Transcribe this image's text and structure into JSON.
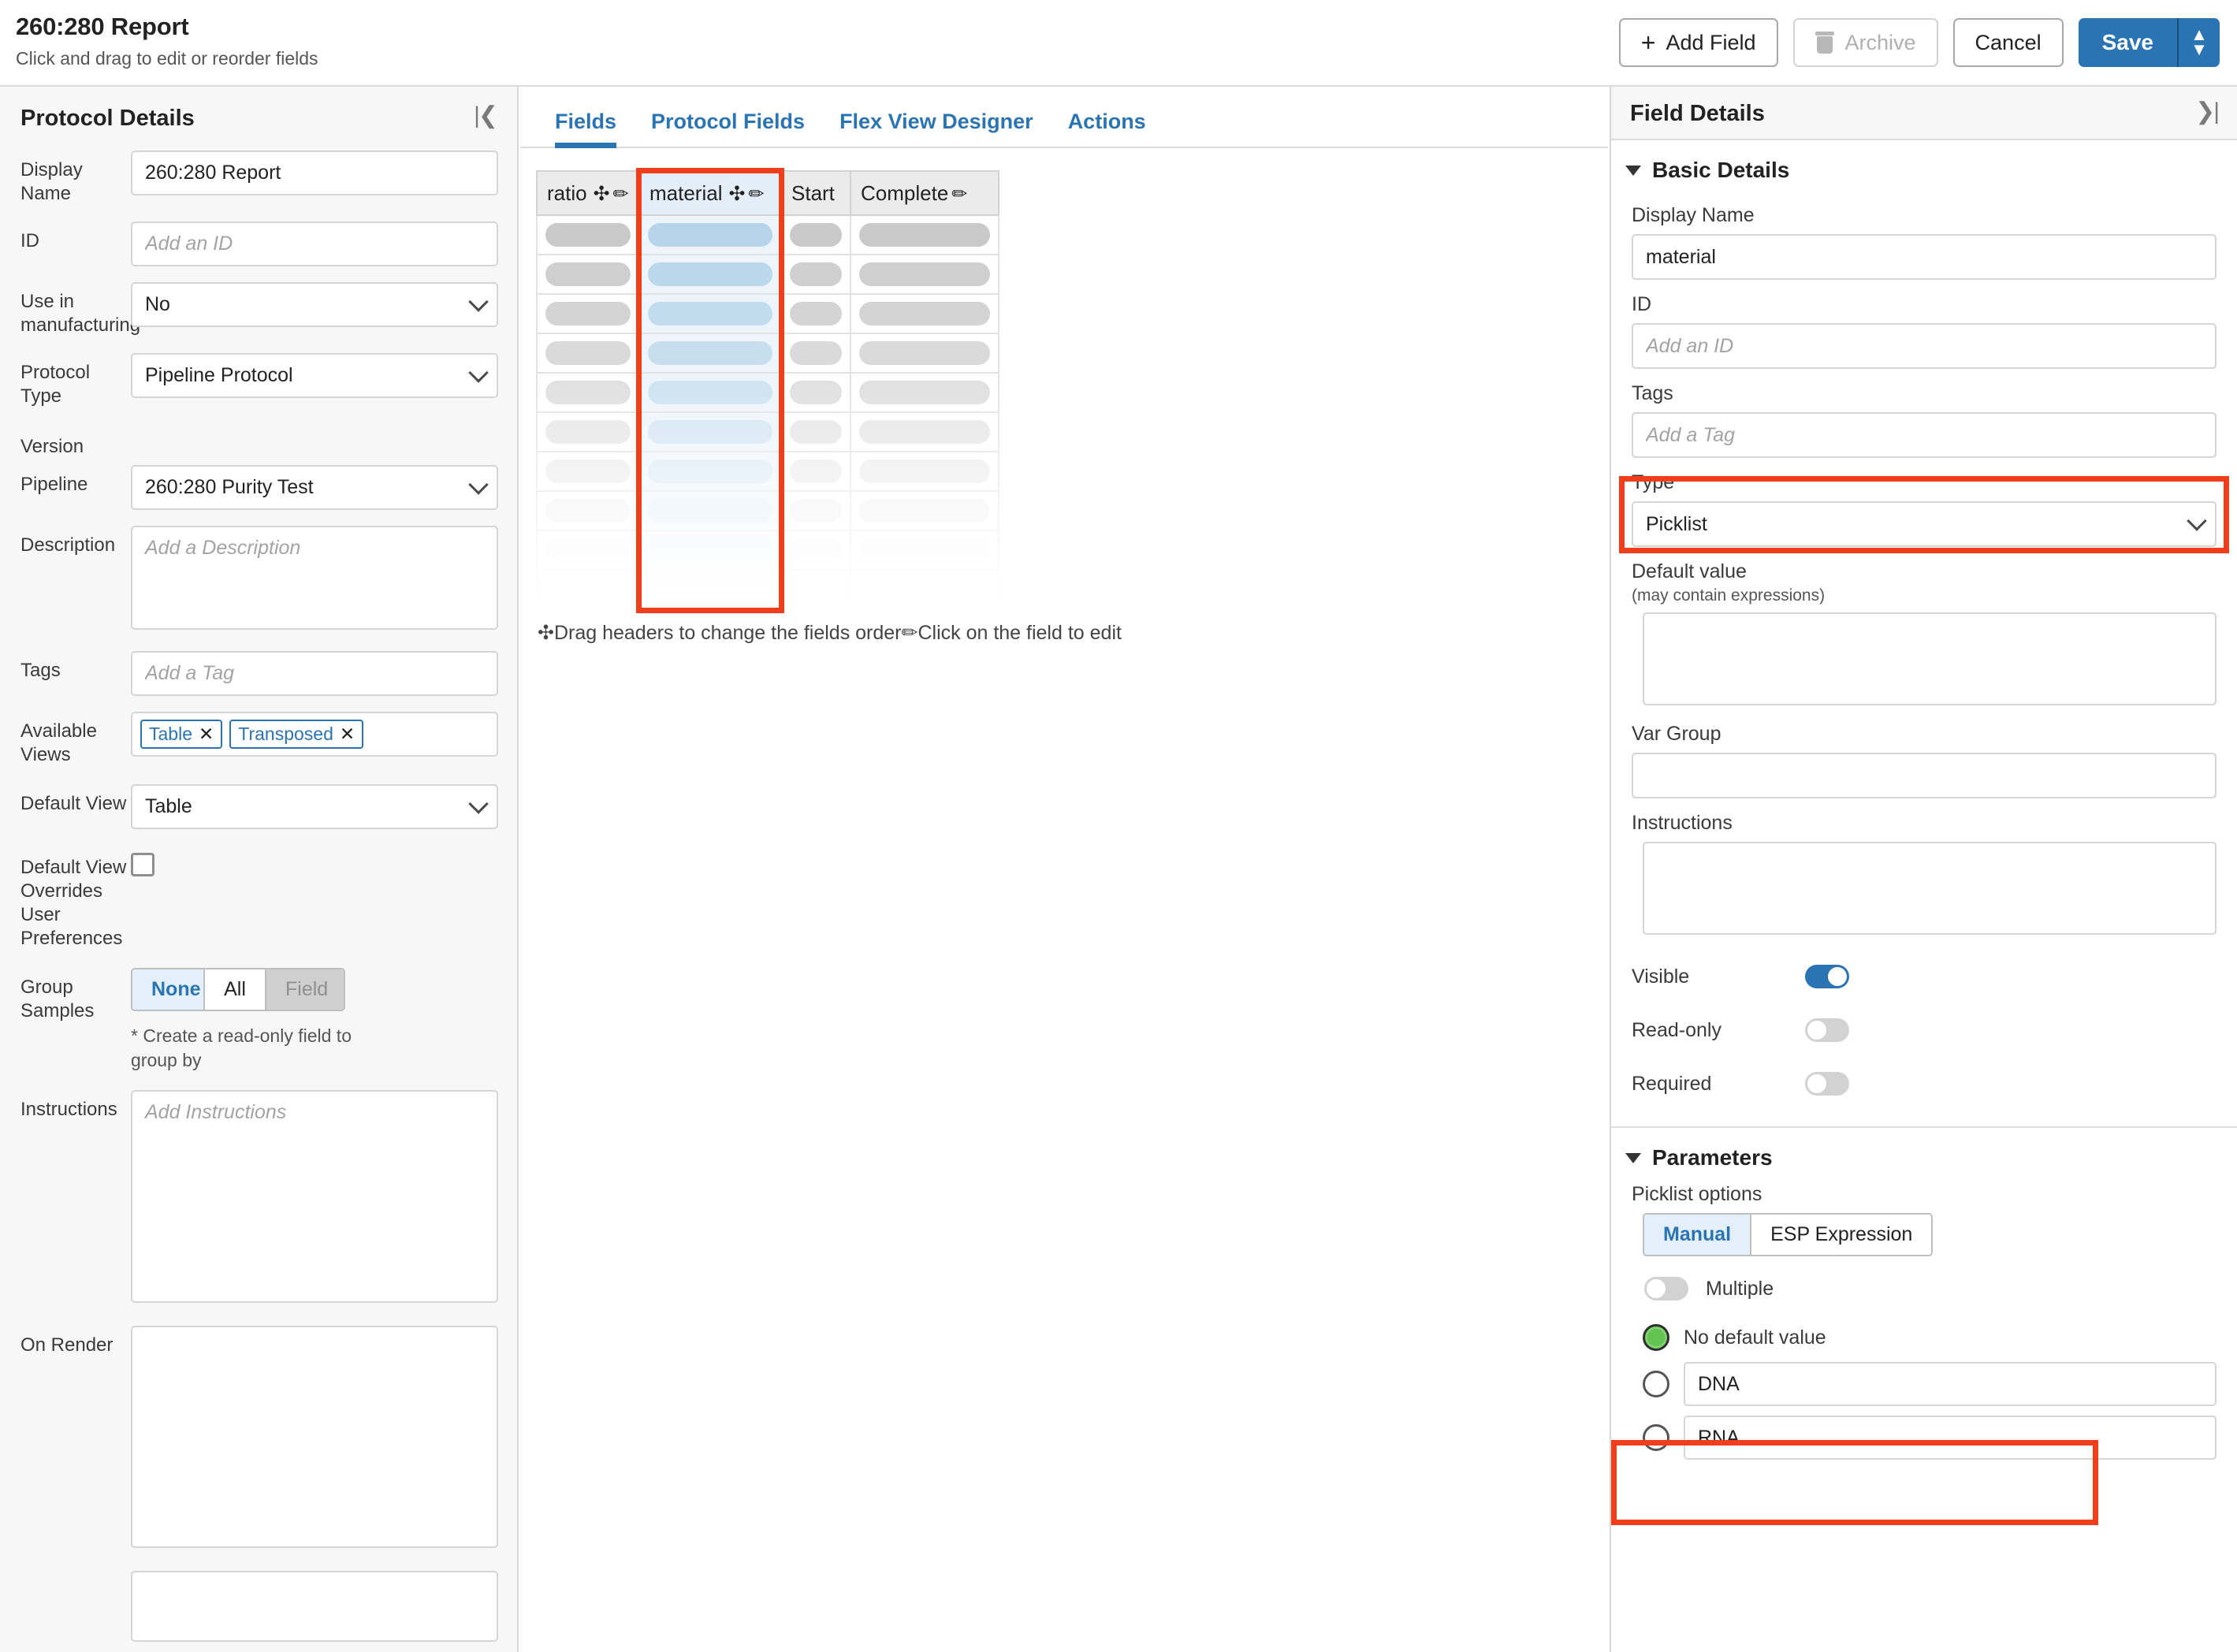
{
  "header": {
    "title": "260:280 Report",
    "subtitle": "Click and drag to edit or reorder fields",
    "add_field_label": "Add Field",
    "archive_label": "Archive",
    "cancel_label": "Cancel",
    "save_label": "Save",
    "accent_color": "#2b74b3",
    "highlight_color": "#f03d1a"
  },
  "left_panel": {
    "title": "Protocol Details",
    "collapse_icon": "collapse-left-icon",
    "display_name": {
      "label": "Display Name",
      "value": "260:280 Report"
    },
    "id": {
      "label": "ID",
      "value": "",
      "placeholder": "Add an ID"
    },
    "use_in_manufacturing": {
      "label": "Use in manufacturing",
      "value": "No"
    },
    "protocol_type": {
      "label": "Protocol Type",
      "value": "Pipeline Protocol"
    },
    "version": {
      "label": "Version",
      "value": ""
    },
    "pipeline": {
      "label": "Pipeline",
      "value": "260:280 Purity Test"
    },
    "description": {
      "label": "Description",
      "value": "",
      "placeholder": "Add a Description"
    },
    "tags": {
      "label": "Tags",
      "value": "",
      "placeholder": "Add a Tag"
    },
    "available_views": {
      "label": "Available Views",
      "chips": [
        "Table",
        "Transposed"
      ]
    },
    "default_view": {
      "label": "Default View",
      "value": "Table"
    },
    "default_view_overrides": {
      "label": "Default View Overrides User Preferences",
      "checked": false
    },
    "group_samples": {
      "label": "Group Samples",
      "options": [
        "None",
        "All",
        "Field"
      ],
      "selected": "None",
      "disabled": [
        "Field"
      ],
      "hint": "* Create a read-only field to group by"
    },
    "instructions": {
      "label": "Instructions",
      "value": "",
      "placeholder": "Add Instructions"
    },
    "on_render": {
      "label": "On Render",
      "value": ""
    }
  },
  "center_panel": {
    "tabs": [
      {
        "label": "Fields",
        "active": true
      },
      {
        "label": "Protocol Fields",
        "active": false
      },
      {
        "label": "Flex View Designer",
        "active": false
      },
      {
        "label": "Actions",
        "active": false
      }
    ],
    "table": {
      "columns": [
        {
          "label": "ratio",
          "has_move": true,
          "has_pencil": true,
          "selected": false,
          "width": 130
        },
        {
          "label": "material",
          "has_move": true,
          "has_pencil": true,
          "selected": true,
          "width": 180
        },
        {
          "label": "Start",
          "has_move": false,
          "has_pencil": false,
          "selected": false,
          "width": 88
        },
        {
          "label": "Complete",
          "has_move": false,
          "has_pencil": true,
          "selected": false,
          "width": 188
        }
      ],
      "row_count": 10
    },
    "legend_move_icon": "move-icon",
    "legend_move_text": "Drag headers to change the fields order",
    "legend_pencil_icon": "pencil-icon",
    "legend_pencil_text": "Click on the field to edit"
  },
  "right_panel": {
    "title": "Field Details",
    "collapse_icon": "collapse-right-icon",
    "basic_details": {
      "section_label": "Basic Details",
      "display_name": {
        "label": "Display Name",
        "value": "material"
      },
      "id": {
        "label": "ID",
        "value": "",
        "placeholder": "Add an ID"
      },
      "tags": {
        "label": "Tags",
        "value": "",
        "placeholder": "Add a Tag"
      },
      "type": {
        "label": "Type",
        "value": "Picklist",
        "highlighted": true
      },
      "default_value": {
        "label": "Default value",
        "sublabel": "(may contain expressions)",
        "value": ""
      },
      "var_group": {
        "label": "Var Group",
        "value": ""
      },
      "instructions": {
        "label": "Instructions",
        "value": ""
      },
      "visible": {
        "label": "Visible",
        "on": true
      },
      "readonly": {
        "label": "Read-only",
        "on": false
      },
      "required": {
        "label": "Required",
        "on": false
      }
    },
    "parameters": {
      "section_label": "Parameters",
      "picklist_options_label": "Picklist options",
      "mode_options": [
        "Manual",
        "ESP Expression"
      ],
      "mode_selected": "Manual",
      "multiple": {
        "label": "Multiple",
        "on": false
      },
      "no_default_value": {
        "label": "No default value",
        "selected": true
      },
      "options": [
        {
          "value": "DNA",
          "selected": false
        },
        {
          "value": "RNA",
          "selected": false
        }
      ]
    }
  }
}
